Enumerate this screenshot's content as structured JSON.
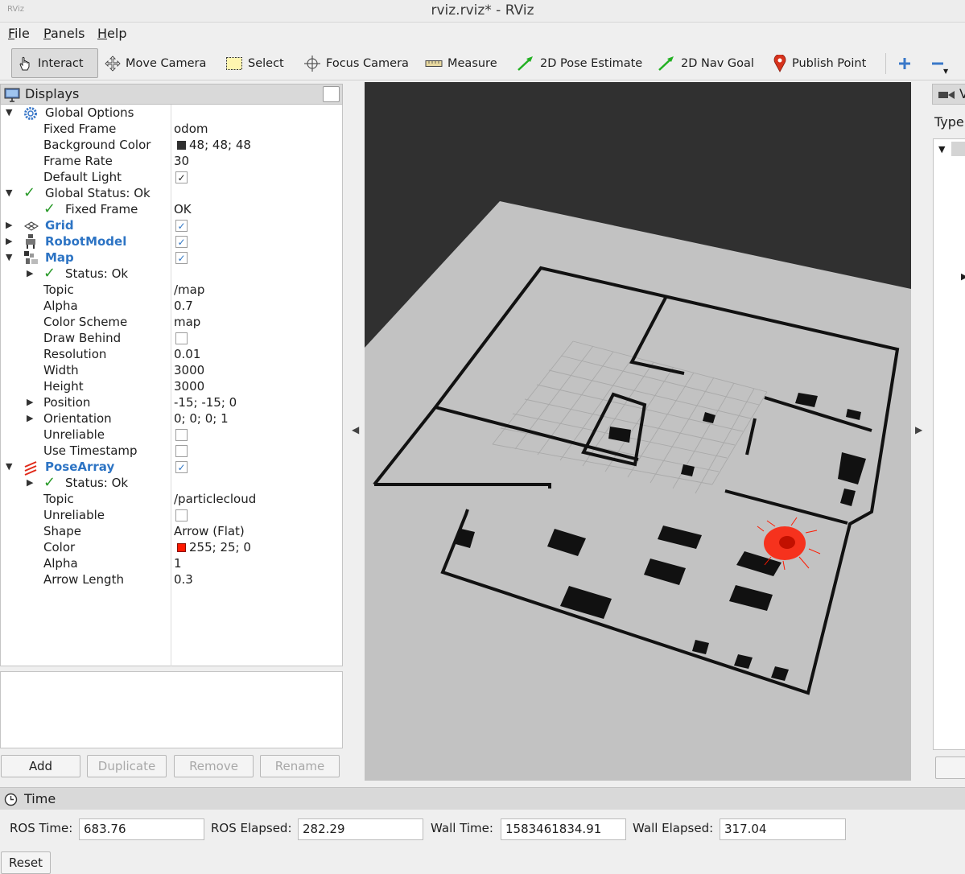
{
  "window": {
    "title": "rviz.rviz* - RViz",
    "app_icon_text": "RViz"
  },
  "menu": {
    "file": "File",
    "panels": "Panels",
    "help": "Help"
  },
  "toolbar": {
    "interact": "Interact",
    "move_camera": "Move Camera",
    "select": "Select",
    "focus_camera": "Focus Camera",
    "measure": "Measure",
    "pose_estimate": "2D Pose Estimate",
    "nav_goal": "2D Nav Goal",
    "publish_point": "Publish Point"
  },
  "displays": {
    "title": "Displays",
    "global_options": {
      "label": "Global Options",
      "fixed_frame_label": "Fixed Frame",
      "fixed_frame": "odom",
      "bg_color_label": "Background Color",
      "bg_color": "48; 48; 48",
      "bg_color_hex": "#303030",
      "frame_rate_label": "Frame Rate",
      "frame_rate": "30",
      "default_light_label": "Default Light"
    },
    "global_status": {
      "label": "Global Status: Ok",
      "fixed_frame_label": "Fixed Frame",
      "fixed_frame_value": "OK"
    },
    "grid": {
      "label": "Grid"
    },
    "robot_model": {
      "label": "RobotModel"
    },
    "map": {
      "label": "Map",
      "status_label": "Status: Ok",
      "topic_label": "Topic",
      "topic": "/map",
      "alpha_label": "Alpha",
      "alpha": "0.7",
      "color_scheme_label": "Color Scheme",
      "color_scheme": "map",
      "draw_behind_label": "Draw Behind",
      "resolution_label": "Resolution",
      "resolution": "0.01",
      "width_label": "Width",
      "width": "3000",
      "height_label": "Height",
      "height": "3000",
      "position_label": "Position",
      "position": "-15; -15; 0",
      "orientation_label": "Orientation",
      "orientation": "0; 0; 0; 1",
      "unreliable_label": "Unreliable",
      "use_timestamp_label": "Use Timestamp"
    },
    "pose_array": {
      "label": "PoseArray",
      "status_label": "Status: Ok",
      "topic_label": "Topic",
      "topic": "/particlecloud",
      "unreliable_label": "Unreliable",
      "shape_label": "Shape",
      "shape": "Arrow (Flat)",
      "color_label": "Color",
      "color": "255; 25; 0",
      "color_hex": "#ff1900",
      "alpha_label": "Alpha",
      "alpha": "1",
      "arrow_length_label": "Arrow Length",
      "arrow_length": "0.3"
    },
    "buttons": {
      "add": "Add",
      "duplicate": "Duplicate",
      "remove": "Remove",
      "rename": "Rename"
    }
  },
  "views": {
    "title": "V",
    "type_label": "Type"
  },
  "time": {
    "title": "Time",
    "ros_time_label": "ROS Time:",
    "ros_time": "683.76",
    "ros_elapsed_label": "ROS Elapsed:",
    "ros_elapsed": "282.29",
    "wall_time_label": "Wall Time:",
    "wall_time": "1583461834.91",
    "wall_elapsed_label": "Wall Elapsed:",
    "wall_elapsed": "317.04",
    "reset": "Reset"
  },
  "colors": {
    "accent_blue": "#2d74c4",
    "ok_green": "#2a9a2a",
    "particle_red": "#ff1900"
  }
}
